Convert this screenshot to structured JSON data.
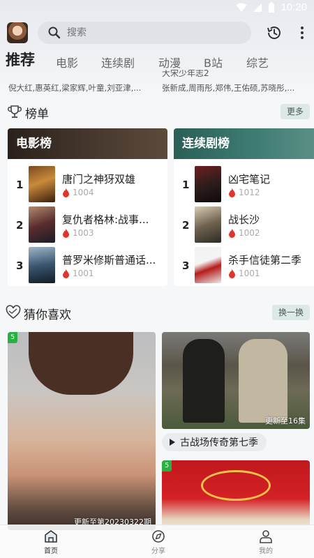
{
  "status": {
    "time": "10:20"
  },
  "search": {
    "placeholder": "搜索"
  },
  "tabs": [
    {
      "label": "推荐",
      "active": true
    },
    {
      "label": "电影"
    },
    {
      "label": "连续剧"
    },
    {
      "label": "动漫"
    },
    {
      "label": "B站"
    },
    {
      "label": "综艺"
    }
  ],
  "peek": [
    {
      "title": "",
      "actors": "倪大红,惠英红,梁家辉,叶童,刘亚津,..."
    },
    {
      "title": "大宋少年志2",
      "actors": "张新成,周雨彤,郑伟,王佑硕,苏晓彤,..."
    }
  ],
  "ranking": {
    "title": "榜单",
    "more_label": "更多",
    "boards": [
      {
        "title": "电影榜",
        "items": [
          {
            "rank": "1",
            "name": "唐门之神犽双雄",
            "heat": "1004"
          },
          {
            "rank": "2",
            "name": "复仇者格林:战事...",
            "heat": "1003"
          },
          {
            "rank": "3",
            "name": "普罗米修斯普通话...",
            "heat": "1001"
          }
        ]
      },
      {
        "title": "连续剧榜",
        "items": [
          {
            "rank": "1",
            "name": "凶宅笔记",
            "heat": "1012"
          },
          {
            "rank": "2",
            "name": "战长沙",
            "heat": "1002"
          },
          {
            "rank": "3",
            "name": "杀手信徒第二季",
            "heat": "1001"
          }
        ]
      }
    ]
  },
  "guess": {
    "title": "猜你喜欢",
    "refresh_label": "换一换",
    "cards": [
      {
        "badge": "5",
        "caption": "更新至第20230322期"
      },
      {
        "caption": "更新至16集",
        "title": "古战场传奇第七季"
      },
      {
        "badge": "5"
      }
    ]
  },
  "bottom_nav": [
    {
      "label": "首页",
      "icon": "home-icon",
      "active": true
    },
    {
      "label": "分享",
      "icon": "compass-icon"
    },
    {
      "label": "我的",
      "icon": "user-icon"
    }
  ],
  "colors": {
    "accent": "#28b040",
    "heat": "#e0352b",
    "movie_board_head": "#3a2f29",
    "tv_board_head": "#2f6f66"
  }
}
